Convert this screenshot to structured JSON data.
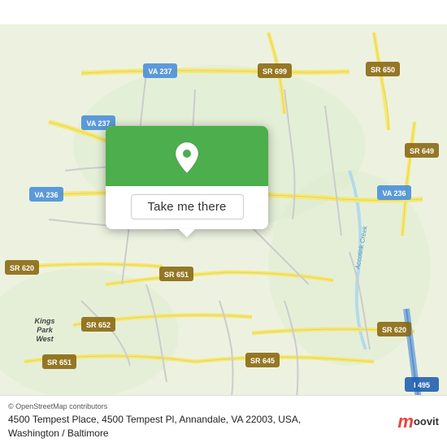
{
  "map": {
    "background_color": "#e8f0d8",
    "center_lat": 38.82,
    "center_lng": -77.19
  },
  "popup": {
    "button_label": "Take me there",
    "header_color": "#4cae4c",
    "pin_color": "white"
  },
  "bottom_bar": {
    "attribution": "© OpenStreetMap contributors",
    "address": "4500 Tempest Place, 4500 Tempest Pl, Annandale, VA 22003, USA, Washington / Baltimore",
    "logo_letter": "m",
    "logo_name": "moovit"
  },
  "road_labels": [
    {
      "id": "va237_top",
      "text": "VA 237"
    },
    {
      "id": "sr699",
      "text": "SR 699"
    },
    {
      "id": "sr650",
      "text": "SR 650"
    },
    {
      "id": "va237_left",
      "text": "VA 237"
    },
    {
      "id": "sr649",
      "text": "SR 649"
    },
    {
      "id": "va236_left",
      "text": "VA 236"
    },
    {
      "id": "va236_right",
      "text": "VA 236"
    },
    {
      "id": "sr620_left",
      "text": "SR 620"
    },
    {
      "id": "sr651_mid",
      "text": "SR 651"
    },
    {
      "id": "sr652",
      "text": "SR 652"
    },
    {
      "id": "sr620_right",
      "text": "SR 620"
    },
    {
      "id": "sr651_bottom",
      "text": "SR 651"
    },
    {
      "id": "sr645",
      "text": "SR 645"
    },
    {
      "id": "i495",
      "text": "I 495"
    },
    {
      "id": "kings_park_west",
      "text": "Kings\nPark\nWest"
    },
    {
      "id": "accotink",
      "text": "Accotink Creek"
    }
  ]
}
